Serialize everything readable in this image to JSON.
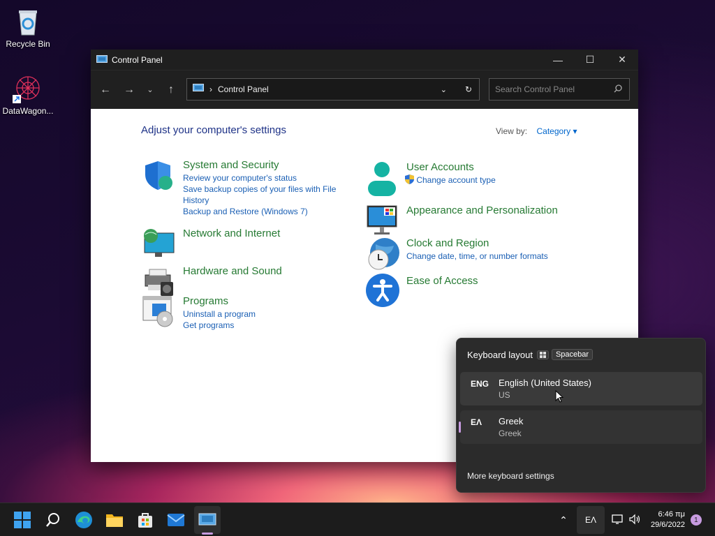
{
  "desktop": {
    "recycle_bin": "Recycle Bin",
    "datawagon": "DataWagon..."
  },
  "window": {
    "title": "Control Panel",
    "address": "Control Panel",
    "search_placeholder": "Search Control Panel"
  },
  "content": {
    "heading": "Adjust your computer's settings",
    "view_by_label": "View by:",
    "view_by_value": "Category",
    "categories": [
      {
        "title": "System and Security",
        "links": [
          "Review your computer's status",
          "Save backup copies of your files with File History",
          "Backup and Restore (Windows 7)"
        ]
      },
      {
        "title": "Network and Internet",
        "links": []
      },
      {
        "title": "Hardware and Sound",
        "links": []
      },
      {
        "title": "Programs",
        "links": [
          "Uninstall a program",
          "Get programs"
        ]
      },
      {
        "title": "User Accounts",
        "links": [
          "Change account type"
        ]
      },
      {
        "title": "Appearance and Personalization",
        "links": []
      },
      {
        "title": "Clock and Region",
        "links": [
          "Change date, time, or number formats"
        ]
      },
      {
        "title": "Ease of Access",
        "links": []
      }
    ]
  },
  "flyout": {
    "title": "Keyboard layout",
    "shortcut": "Spacebar",
    "languages": [
      {
        "code": "ENG",
        "name": "English (United States)",
        "layout": "US"
      },
      {
        "code": "ΕΛ",
        "name": "Greek",
        "layout": "Greek"
      }
    ],
    "more": "More keyboard settings"
  },
  "taskbar": {
    "lang_indicator": "ΕΛ",
    "time": "6:46 πμ",
    "date": "29/6/2022",
    "notification_count": "1"
  },
  "colors": {
    "accent": "#1a5fb4",
    "category_green": "#267a33",
    "heading_blue": "#1e3287"
  }
}
